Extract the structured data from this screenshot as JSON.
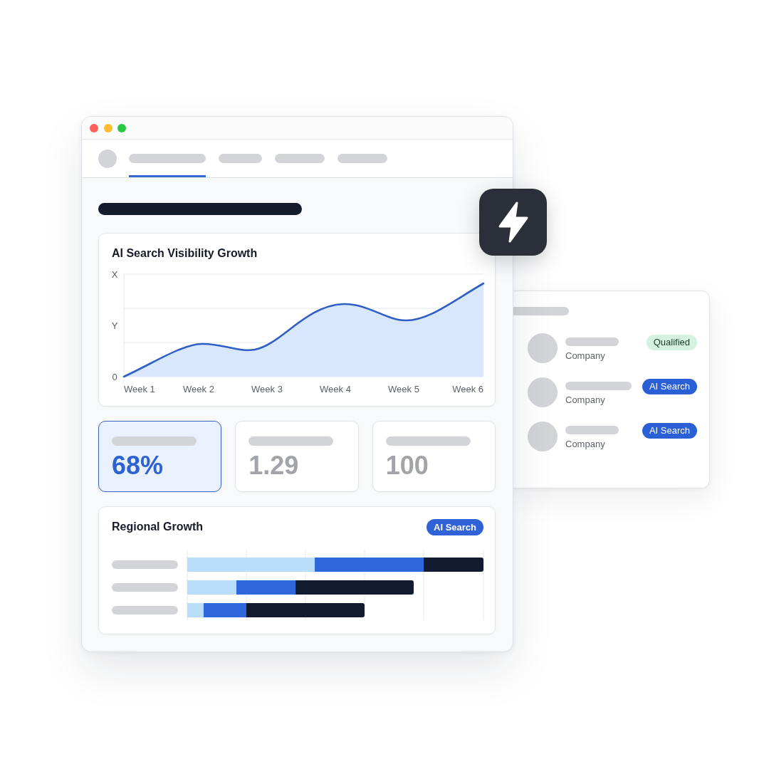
{
  "nav": {
    "tabs": [
      {
        "selected": true
      },
      {
        "selected": false
      },
      {
        "selected": false
      },
      {
        "selected": false
      }
    ]
  },
  "visibility_chart": {
    "title": "AI Search Visibility Growth",
    "y_labels": [
      "X",
      "Y",
      "0"
    ],
    "x_labels": [
      "Week 1",
      "Week 2",
      "Week 3",
      "Week 4",
      "Week 5",
      "Week 6"
    ]
  },
  "stats": [
    {
      "value": "68%",
      "selected": true
    },
    {
      "value": "1.29",
      "selected": false
    },
    {
      "value": "100",
      "selected": false
    }
  ],
  "regional_growth": {
    "title": "Regional Growth",
    "badge": "AI Search"
  },
  "leads": [
    {
      "company": "Company",
      "tag": {
        "label": "Qualified",
        "color": "#d4f2df"
      }
    },
    {
      "company": "Company",
      "tag": {
        "label": "AI Search",
        "color": "#2a5fd6"
      }
    },
    {
      "company": "Company",
      "tag": {
        "label": "AI Search",
        "color": "#2a5fd6"
      }
    }
  ]
}
